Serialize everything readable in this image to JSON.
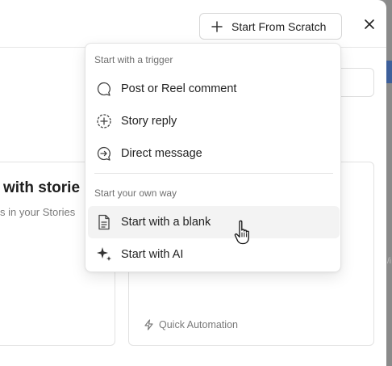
{
  "header": {
    "start_from_scratch_label": "Start From Scratch",
    "close_icon": "close-icon",
    "plus_icon": "plus-icon"
  },
  "background": {
    "card_left_title": "with storie",
    "card_left_subtitle": "s in your Stories",
    "card_right_tag": "Quick Automation",
    "backdrop_mark": "/i"
  },
  "dropdown": {
    "trigger_section_label": "Start with a trigger",
    "trigger_items": [
      {
        "label": "Post or Reel comment",
        "icon": "comment-bubble-icon"
      },
      {
        "label": "Story reply",
        "icon": "circle-plus-icon"
      },
      {
        "label": "Direct message",
        "icon": "circle-arrow-icon"
      }
    ],
    "own_way_section_label": "Start your own way",
    "own_way_items": [
      {
        "label": "Start with a blank",
        "icon": "document-icon"
      },
      {
        "label": "Start with AI",
        "icon": "sparkle-icon"
      }
    ]
  },
  "colors": {
    "backdrop": "#8e8e8e",
    "accent_blue": "#3d5f9a",
    "hover_bg": "#f3f3f3"
  }
}
